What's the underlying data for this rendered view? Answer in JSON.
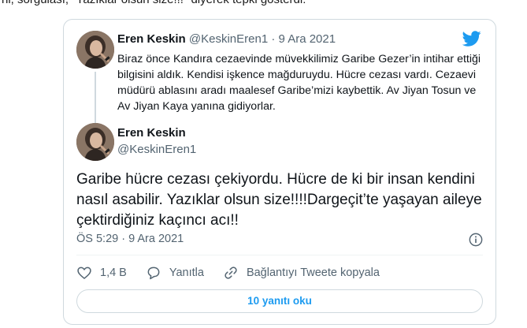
{
  "page": {
    "top_text": "ni, sorgulası, \"Yazıklar olsun size!!!\" diyerek tepki gösterdi:"
  },
  "quoted": {
    "name": "Eren Keskin",
    "handle": "@KeskinEren1",
    "separator": " · ",
    "date": "9 Ara 2021",
    "text": "Biraz önce Kandıra cezaevinde müvekkilimiz Garibe Gezer’in intihar ettiği bilgisini aldık. Kendisi işkence mağduruydu. Hücre cezası vardı. Cezaevi müdürü ablasını aradı maalesef Garibe’mizi kaybettik. Av Jiyan Tosun ve Av Jiyan Kaya yanına gidiyorlar."
  },
  "tweet": {
    "name": "Eren Keskin",
    "handle": "@KeskinEren1",
    "text": "Garibe hücre cezası çekiyordu. Hücre de ki bir insan kendini nasıl asabilir. Yazıklar olsun size!!!!Dargeçit’te yaşayan aileye çektirdiğiniz kaçıncı acı!!",
    "timestamp": "ÖS 5:29 · 9 Ara 2021"
  },
  "actions": {
    "likes": "1,4 B",
    "reply_label": "Yanıtla",
    "copy_label": "Bağlantıyı Tweete kopyala"
  },
  "replies_button": "10 yanıtı oku",
  "colors": {
    "twitter_blue": "#1d9bf0",
    "text_primary": "#0f1419",
    "text_secondary": "#536471",
    "border": "#cfd9de"
  }
}
